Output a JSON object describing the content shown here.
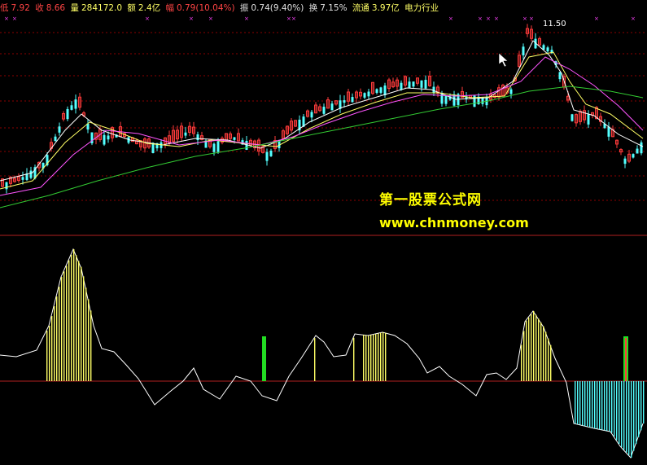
{
  "colors": {
    "background": "#000000",
    "up_candle": "#ff3b3b",
    "down_candle": "#54ffff",
    "ma5": "#ffffff",
    "ma10": "#ffff66",
    "ma20": "#ff55ff",
    "ma60": "#33cc33",
    "grid": "#8b0000",
    "panel_divider": "#b02020",
    "signal": "#ff44ff",
    "osc_line": "#ffffff",
    "osc_pos": "#ffff66",
    "osc_neg": "#54ffff",
    "osc_green": "#22dd22",
    "watermark": "#ffff00"
  },
  "infobar": {
    "low_label": "低",
    "low": "7.92",
    "close_label": "收",
    "close": "8.66",
    "vol_label": "量",
    "vol": "284172.0",
    "amount_label": "额",
    "amount": "2.4亿",
    "range_label": "幅",
    "range": "0.79(10.04%)",
    "amp_label": "振",
    "amp": "0.74(9.40%)",
    "turnover_label": "换",
    "turnover": "7.15%",
    "float_label": "流通",
    "float": "3.97亿",
    "industry": "电力行业"
  },
  "price_label": "11.50",
  "watermark": {
    "line1": "第一股票公式网",
    "line2": "www.chnmoney.com"
  }
}
